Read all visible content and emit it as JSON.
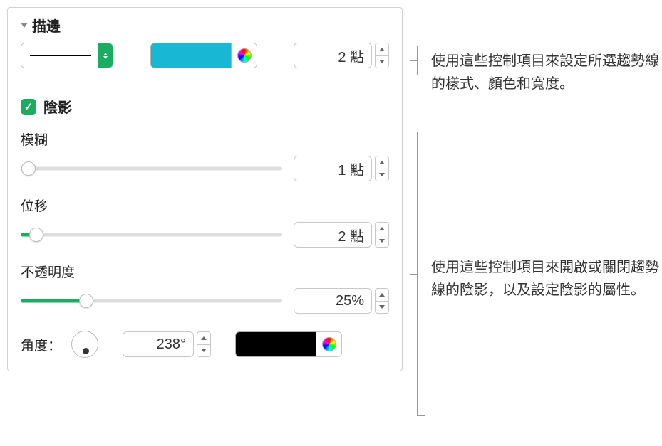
{
  "stroke": {
    "section_title": "描邊",
    "width_value": "2 點",
    "color": "#18b7d4"
  },
  "shadow": {
    "checkbox_label": "陰影",
    "checked": true,
    "blur": {
      "label": "模糊",
      "value": "1 點",
      "percent": 3
    },
    "offset": {
      "label": "位移",
      "value": "2 點",
      "percent": 6
    },
    "opacity": {
      "label": "不透明度",
      "value": "25%",
      "percent": 25
    },
    "angle": {
      "label": "角度：",
      "value": "238°"
    },
    "color": "#000000"
  },
  "callouts": {
    "c1": "使用這些控制項目來設定所選趨勢線的樣式、顏色和寬度。",
    "c2": "使用這些控制項目來開啟或關閉趨勢線的陰影，以及設定陰影的屬性。"
  }
}
